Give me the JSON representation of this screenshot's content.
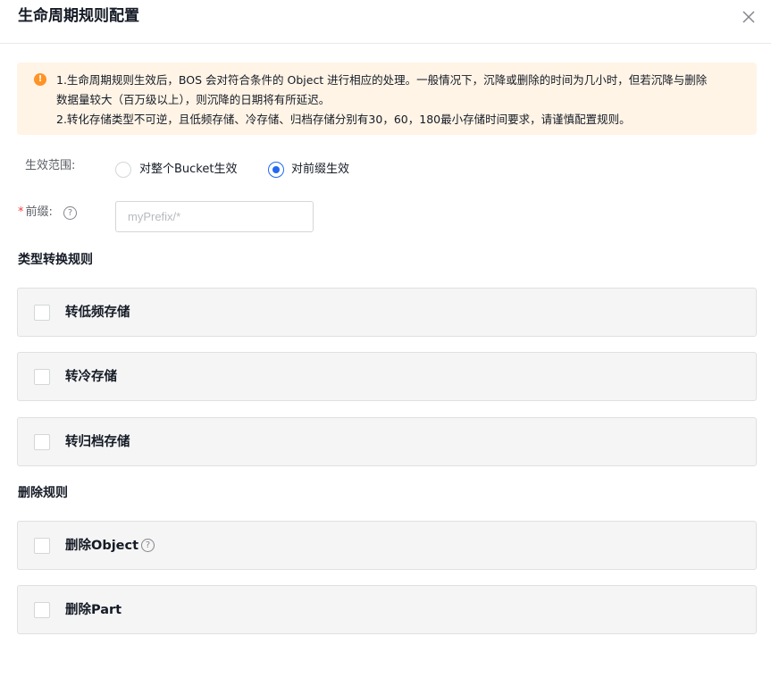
{
  "dialog": {
    "title": "生命周期规则配置",
    "close_icon": "close-icon"
  },
  "alert": {
    "icon": "warning-icon",
    "lines": [
      "1.生命周期规则生效后，BOS 会对符合条件的 Object 进行相应的处理。一般情况下，沉降或删除的时间为几小时，但若沉降与删除",
      "数据量较大（百万级以上），则沉降的日期将有所延迟。",
      "2.转化存储类型不可逆，且低频存储、冷存储、归档存储分别有30，60，180最小存储时间要求，请谨慎配置规则。"
    ]
  },
  "scope": {
    "label": "生效范围:",
    "options": [
      {
        "label": "对整个Bucket生效",
        "checked": false
      },
      {
        "label": "对前缀生效",
        "checked": true
      }
    ]
  },
  "prefix": {
    "required_mark": "*",
    "label": "前缀:",
    "help_icon": "help-icon",
    "value": "",
    "placeholder": "myPrefix/*"
  },
  "transition": {
    "title": "类型转换规则",
    "items": [
      {
        "label": "转低频存储",
        "checked": false
      },
      {
        "label": "转冷存储",
        "checked": false
      },
      {
        "label": "转归档存储",
        "checked": false
      }
    ]
  },
  "deletion": {
    "title": "删除规则",
    "items": [
      {
        "label": "删除Object",
        "checked": false,
        "has_help": true
      },
      {
        "label": "删除Part",
        "checked": false,
        "has_help": false
      }
    ]
  },
  "colors": {
    "primary": "#2468f2",
    "warning": "#ff9326",
    "alert_bg": "#fff4e6",
    "panel_bg": "#f5f5f5",
    "required": "#f33e3e"
  }
}
